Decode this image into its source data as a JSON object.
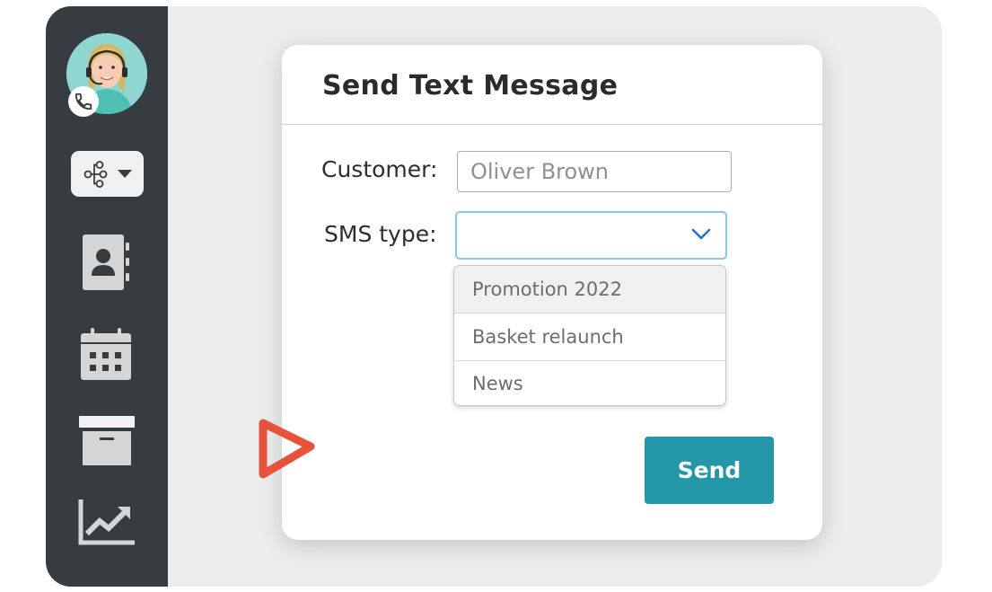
{
  "sidebar": {
    "avatar": "agent-avatar",
    "call_badge_icon": "phone-icon",
    "flow_menu_icon": "workflow-icon",
    "flow_menu_arrow": "caret-down-icon",
    "nav": [
      {
        "icon": "contacts-icon"
      },
      {
        "icon": "calendar-icon"
      },
      {
        "icon": "archive-icon"
      },
      {
        "icon": "analytics-icon"
      }
    ]
  },
  "dialog": {
    "title": "Send Text Message",
    "customer_label": "Customer:",
    "customer_placeholder": "Oliver Brown",
    "sms_type_label": "SMS type:",
    "sms_type_value": "",
    "sms_options": [
      "Promotion 2022",
      "Basket relaunch",
      "News"
    ],
    "send_label": "Send"
  },
  "colors": {
    "sidebar": "#363c40",
    "accent": "#2397a8",
    "focus_border": "#8cc5ef",
    "decor": "#e5533d",
    "background": "#ebeced"
  }
}
